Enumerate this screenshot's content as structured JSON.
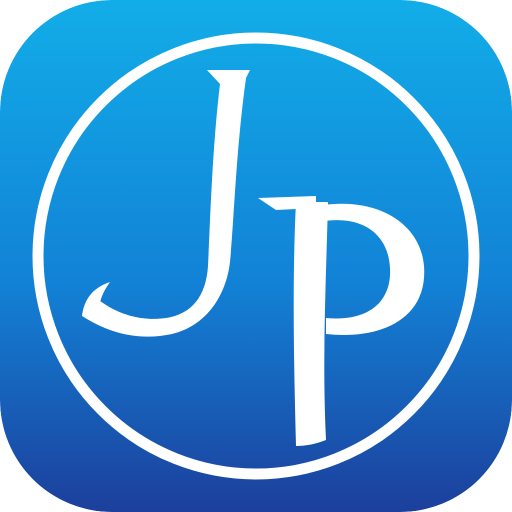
{
  "app_icon": {
    "monogram": "JP",
    "colors": {
      "gradient_top": "#12ADE8",
      "gradient_mid": "#1282D6",
      "gradient_bottom": "#1C3F9C",
      "foreground": "#FFFFFF"
    }
  }
}
